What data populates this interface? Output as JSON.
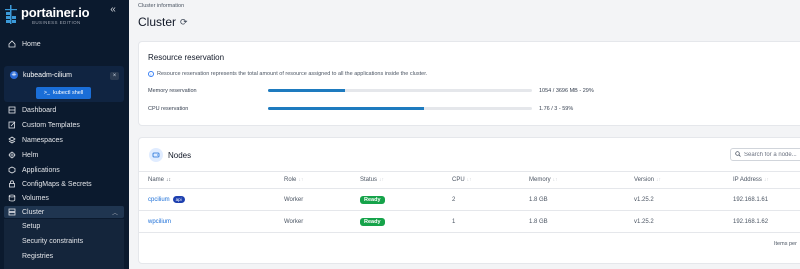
{
  "brand": {
    "name": "portainer.io",
    "edition": "BUSINESS EDITION",
    "collapse_icon": "double-chevron-left-icon"
  },
  "nav": {
    "home": "Home",
    "environment": {
      "name": "kubeadm-cilium",
      "close": "×",
      "shell_button": "kubectl shell"
    },
    "items": [
      {
        "label": "Dashboard",
        "icon": "dashboard-icon"
      },
      {
        "label": "Custom Templates",
        "icon": "edit-icon"
      },
      {
        "label": "Namespaces",
        "icon": "layers-icon"
      },
      {
        "label": "Helm",
        "icon": "helm-icon"
      },
      {
        "label": "Applications",
        "icon": "applications-icon"
      },
      {
        "label": "ConfigMaps & Secrets",
        "icon": "lock-icon"
      },
      {
        "label": "Volumes",
        "icon": "database-icon"
      },
      {
        "label": "Cluster",
        "icon": "server-icon"
      }
    ],
    "cluster_sub": [
      "Setup",
      "Security constraints",
      "Registries"
    ]
  },
  "header": {
    "breadcrumb": "Cluster information",
    "title": "Cluster"
  },
  "reservation": {
    "title": "Resource reservation",
    "info": "Resource reservation represents the total amount of resource assigned to all the applications inside the cluster.",
    "rows": [
      {
        "label": "Memory reservation",
        "value": "1054 / 3696 MB - 29%",
        "percent": 29
      },
      {
        "label": "CPU reservation",
        "value": "1.76 / 3 - 59%",
        "percent": 59
      }
    ]
  },
  "nodes": {
    "title": "Nodes",
    "search_placeholder": "Search for a node...",
    "columns": [
      "Name",
      "Role",
      "Status",
      "CPU",
      "Memory",
      "Version",
      "IP Address"
    ],
    "rows": [
      {
        "name": "cpcilium",
        "badge": "api",
        "role": "Worker",
        "status": "Ready",
        "cpu": "2",
        "memory": "1.8 GB",
        "version": "v1.25.2",
        "ip": "192.168.1.61"
      },
      {
        "name": "wpcilium",
        "badge": "",
        "role": "Worker",
        "status": "Ready",
        "cpu": "1",
        "memory": "1.8 GB",
        "version": "v1.25.2",
        "ip": "192.168.1.62"
      }
    ],
    "footer": "Items per"
  },
  "colors": {
    "sidebar": "#0b1a2e",
    "accent": "#1a6ed8",
    "progress": "#1e7bbf",
    "ready": "#16a34a"
  }
}
